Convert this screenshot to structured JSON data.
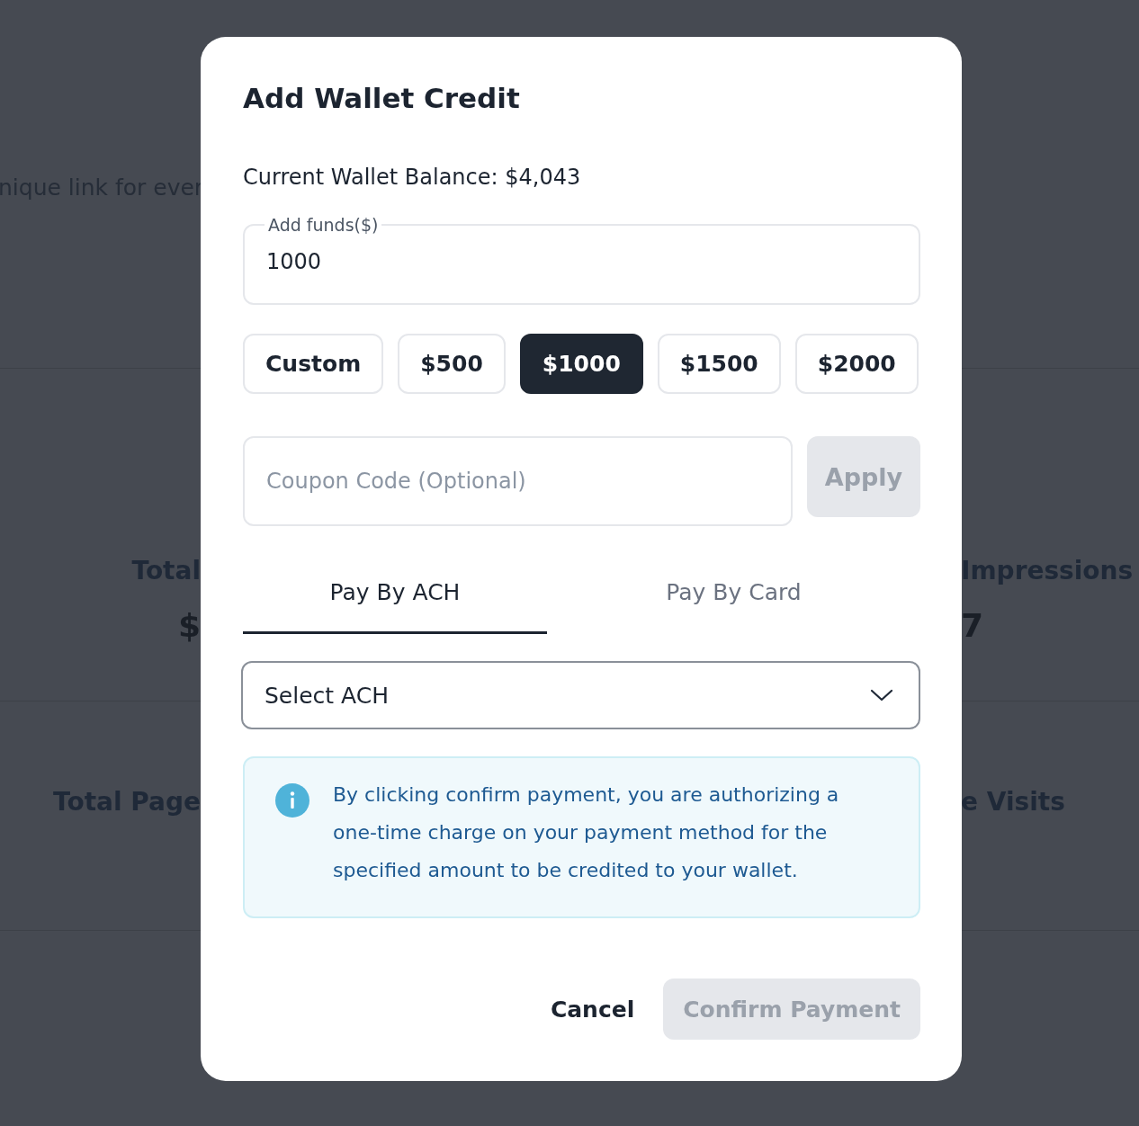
{
  "background": {
    "intro_text": "nique link for ever",
    "stats": [
      {
        "label": "Total",
        "value": "$"
      },
      {
        "label": "Impressions",
        "value": "7"
      }
    ],
    "stats_row_2": [
      {
        "label": "Total Page"
      },
      {
        "label": "e Visits"
      }
    ]
  },
  "modal": {
    "title": "Add Wallet Credit",
    "balance": "Current Wallet Balance: $4,043",
    "funds_field": {
      "label": "Add funds($)",
      "value": "1000"
    },
    "presets": [
      {
        "label": "Custom",
        "selected": false
      },
      {
        "label": "$500",
        "selected": false
      },
      {
        "label": "$1000",
        "selected": true
      },
      {
        "label": "$1500",
        "selected": false
      },
      {
        "label": "$2000",
        "selected": false
      }
    ],
    "coupon": {
      "placeholder": "Coupon Code (Optional)",
      "apply": "Apply",
      "apply_disabled": true
    },
    "tabs": [
      {
        "label": "Pay By ACH",
        "selected": true
      },
      {
        "label": "Pay By Card",
        "selected": false
      }
    ],
    "select": {
      "value": "Select ACH"
    },
    "info": "By clicking confirm payment, you are authorizing a one-time charge on your payment method for the specified amount to be credited to your wallet.",
    "cancel": "Cancel",
    "confirm": {
      "label": "Confirm Payment",
      "disabled": true
    }
  }
}
